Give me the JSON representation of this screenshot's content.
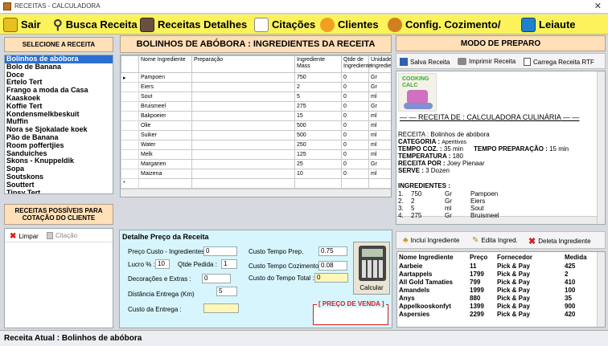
{
  "window": {
    "title": "RECEITAS - CALCULADORA"
  },
  "menu": [
    {
      "label": "Sair",
      "icon": "exit-icon"
    },
    {
      "label": "Busca Receita",
      "icon": "search-icon"
    },
    {
      "label": "Receitas Detalhes",
      "icon": "recipe-book-icon"
    },
    {
      "label": "Citações",
      "icon": "pencil-note-icon"
    },
    {
      "label": "Clientes",
      "icon": "clients-icon"
    },
    {
      "label": "Config. Cozimento/",
      "icon": "cooking-config-icon"
    },
    {
      "label": "Leiaute",
      "icon": "layout-icon"
    }
  ],
  "left": {
    "select_header": "SELECIONE A RECEITA",
    "recipes": [
      "Bolinhos de abóbora",
      "Bolo de Banana",
      "Doce",
      "Ertelo Tert",
      "Frango a moda da Casa",
      "Kaaskoek",
      "Koffie Tert",
      "Kondensmelkbeskuit",
      "Muffin",
      "Nora se Sjokalade koek",
      "Pão de Banana",
      "Room poffertjies",
      "Sanduiches",
      "Skons - Knuppeldik",
      "Sopa",
      "Soutskons",
      "Souttert",
      "Tipsy Tert"
    ],
    "selected_index": 0,
    "possible_header": "RECEITAS POSSÍVEIS PARA COTAÇÃO DO CLIENTE",
    "clear_label": "Limpar",
    "quote_label": "Citação"
  },
  "ingredients": {
    "header": "BOLINHOS DE ABÓBORA : INGREDIENTES DA RECEITA",
    "columns": [
      "Nome Ingrediente",
      "Preparação",
      "Ingrediente Mass",
      "Qtde de Ingrediente",
      "Unidade Ingredien"
    ],
    "rows": [
      [
        "Pampoen",
        "",
        "750",
        "0",
        "Gr"
      ],
      [
        "Eiers",
        "",
        "2",
        "0",
        "Gr"
      ],
      [
        "Sout",
        "",
        "5",
        "0",
        "ml"
      ],
      [
        "Bruismeel",
        "",
        "275",
        "0",
        "Gr"
      ],
      [
        "Bakpoeier",
        "",
        "15",
        "0",
        "ml"
      ],
      [
        "Olie",
        "",
        "500",
        "0",
        "ml"
      ],
      [
        "Suiker",
        "",
        "500",
        "0",
        "ml"
      ],
      [
        "Water",
        "",
        "250",
        "0",
        "ml"
      ],
      [
        "Melk",
        "",
        "125",
        "0",
        "ml"
      ],
      [
        "Margarien",
        "",
        "25",
        "0",
        "Gr"
      ],
      [
        "Maizena",
        "",
        "10",
        "0",
        "ml"
      ]
    ],
    "new_row_marker": "*",
    "current_row_marker": "▸"
  },
  "price": {
    "header": "Detalhe Preço da Receita",
    "cost_ingredients_label": "Preço Custo - Ingredientes",
    "cost_ingredients_value": "0",
    "profit_label": "Lucro % :",
    "profit_value": "10",
    "qty_label": "Qtde Pedida :",
    "qty_value": "1",
    "decor_label": "Decorações e Extras :",
    "decor_value": "0",
    "distance_label": "Distância Entrega (Km)",
    "distance_value": "5",
    "delivery_label": "Custo da Entrega :",
    "delivery_value": "",
    "prep_cost_label": "Custo Tempo Prep.",
    "prep_cost_value": "0.75",
    "cook_cost_label": "Custo Tempo Cozimento",
    "cook_cost_value": "0.08",
    "total_time_label": "Custo do Tempo Total :",
    "total_time_value": "0",
    "calc_label": "Calcular",
    "sale_price_label": "[ PREÇO DE VENDA ]",
    "sale_price_value": ""
  },
  "prep": {
    "header": "MODO DE PREPARO",
    "save_label": "Salva Receita",
    "print_label": "Imprimir Receita",
    "load_label": "Carrega Receita RTF",
    "logo_text": "COOKING CALC",
    "recipe_title": "RECEITA DE : CALCULADORA CULINÁRIA",
    "recipe_line": "RECEITA : Bolinhos de abóbora",
    "category_key": "CATEGORIA :",
    "category_val": "Aperitivos",
    "time_cook_key": "TEMPO COZ. :",
    "time_cook_val": "35 min",
    "time_prep_key": "TEMPO PREPARAÇÃO :",
    "time_prep_val": "15 min",
    "temp_key": "TEMPERATURA :",
    "temp_val": "180",
    "author_key": "RECEITA POR :",
    "author_val": "Joey Pienaar",
    "serve_key": "SERVE :",
    "serve_val": "3 Dozen",
    "ing_title": "INGREDIENTES :",
    "ing_lines": [
      [
        "1.",
        "750",
        "Gr",
        "Pampoen"
      ],
      [
        "2.",
        "2",
        "Gr",
        "Eiers"
      ],
      [
        "3.",
        "5",
        "ml",
        "Sout"
      ],
      [
        "4.",
        "275",
        "Gr",
        "Bruismeel"
      ]
    ]
  },
  "supplier": {
    "add_label": "Inclui Ingrediente",
    "edit_label": "Edita Ingred.",
    "delete_label": "Deleta Ingrediente",
    "columns": [
      "Nome Ingrediente",
      "Preço",
      "Fornecedor",
      "Medida"
    ],
    "rows": [
      [
        "Aarbeie",
        "11",
        "Pick & Pay",
        "425"
      ],
      [
        "Aartappels",
        "1799",
        "Pick & Pay",
        "2"
      ],
      [
        "All Gold Tamaties",
        "799",
        "Pick & Pay",
        "410"
      ],
      [
        "Amandels",
        "1999",
        "Pick & Pay",
        "100"
      ],
      [
        "Anys",
        "880",
        "Pick & Pay",
        "35"
      ],
      [
        "Appelkooskonfyt",
        "1399",
        "Pick & Pay",
        "900"
      ],
      [
        "Aspersies",
        "2299",
        "Pick & Pay",
        "420"
      ]
    ]
  },
  "status": {
    "text": "Receita Atual : Bolinhos de abóbora"
  },
  "colors": {
    "menu_bg": "#fcf35a",
    "header_bg": "#ffe0b8",
    "price_bg": "#d7f5fc",
    "sale_red": "#d02020",
    "selected": "#2d6fd0"
  }
}
